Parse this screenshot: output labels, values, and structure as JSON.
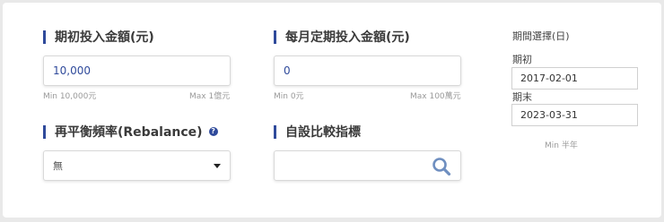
{
  "initial": {
    "title": "期初投入金額(元)",
    "value": "10,000",
    "min_hint": "Min 10,000元",
    "max_hint": "Max 1億元"
  },
  "monthly": {
    "title": "每月定期投入金額(元)",
    "value": "0",
    "min_hint": "Min 0元",
    "max_hint": "Max 100萬元"
  },
  "rebalance": {
    "title": "再平衡頻率(Rebalance)",
    "help_symbol": "?",
    "selected": "無"
  },
  "benchmark": {
    "title": "自設比較指標",
    "value": ""
  },
  "period": {
    "title": "期間選擇(日)",
    "start_label": "期初",
    "start_value": "2017-02-01",
    "end_label": "期末",
    "end_value": "2023-03-31",
    "min_hint": "Min 半年"
  },
  "colors": {
    "accent": "#2f4a9b",
    "search_icon": "#6f8fc0"
  },
  "icons": {
    "help": "question-circle-icon",
    "dropdown": "caret-down-icon",
    "search": "magnifier-icon"
  }
}
